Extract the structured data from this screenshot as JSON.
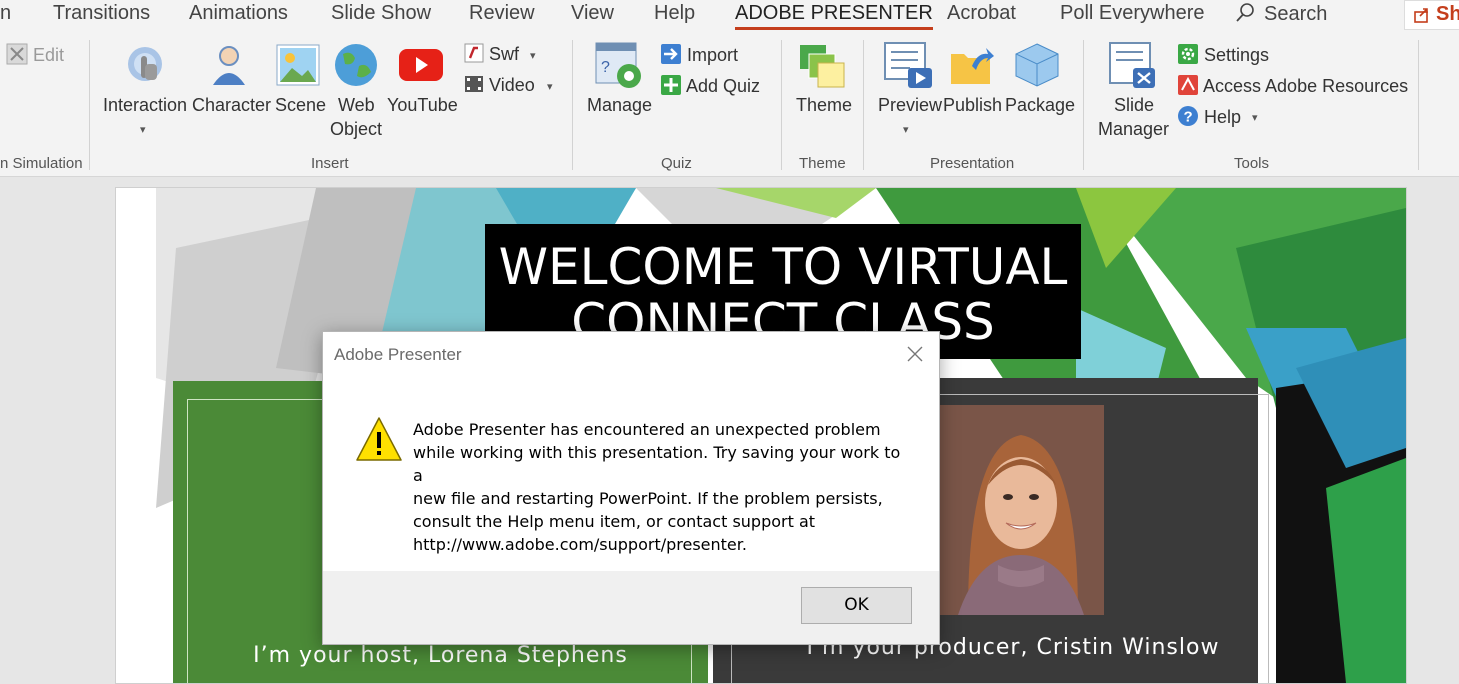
{
  "tabs": [
    "Transitions",
    "Animations",
    "Slide Show",
    "Review",
    "View",
    "Help",
    "ADOBE PRESENTER",
    "Acrobat",
    "Poll Everywhere"
  ],
  "tab_clip_left": "n",
  "active_tab": "ADOBE PRESENTER",
  "search_label": "Search",
  "share_label": "Sh",
  "ribbon": {
    "edit_label": "Edit",
    "sim_group_label": "n Simulation",
    "insert": {
      "interaction": "Interaction",
      "character": "Character",
      "scene": "Scene",
      "web_object_1": "Web",
      "web_object_2": "Object",
      "youtube": "YouTube",
      "swf": "Swf",
      "video": "Video",
      "group": "Insert"
    },
    "quiz": {
      "manage": "Manage",
      "import": "Import",
      "add_quiz": "Add Quiz",
      "group": "Quiz"
    },
    "theme": {
      "theme": "Theme",
      "group": "Theme"
    },
    "presentation": {
      "preview": "Preview",
      "publish": "Publish",
      "package": "Package",
      "group": "Presentation"
    },
    "tools": {
      "slide_manager_1": "Slide",
      "slide_manager_2": "Manager",
      "settings": "Settings",
      "access": "Access Adobe Resources",
      "help": "Help",
      "group": "Tools"
    }
  },
  "slide": {
    "title_line1": "WELCOME TO VIRTUAL",
    "title_line2": "CONNECT CLASS",
    "host": "I’m your host, Lorena Stephens",
    "producer": "I’m your producer, Cristin Winslow"
  },
  "dialog": {
    "title": "Adobe Presenter",
    "message_lines": [
      "Adobe Presenter has encountered an unexpected problem",
      "while working with this presentation.  Try saving your work to a",
      "new file and restarting PowerPoint.  If the problem persists,",
      "consult the Help menu item, or contact support at",
      "http://www.adobe.com/support/presenter."
    ],
    "ok_label": "OK"
  },
  "colors": {
    "accent": "#c43e1c",
    "host_panel": "#4b8a37",
    "producer_panel": "#3a3a3a"
  }
}
